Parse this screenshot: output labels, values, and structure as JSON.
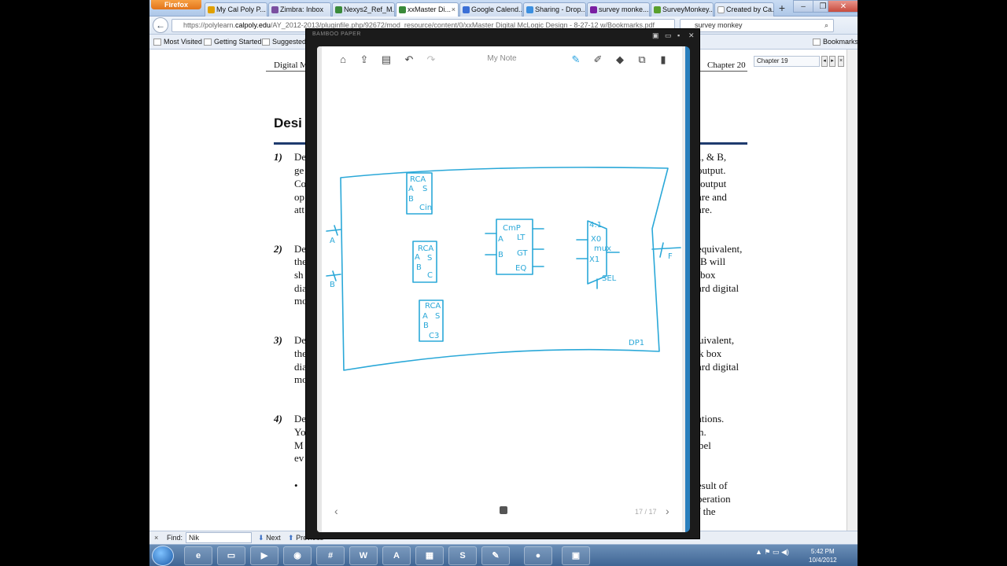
{
  "browser": {
    "app_button": "Firefox",
    "tabs": [
      {
        "label": "My Cal Poly P...",
        "color": "#e0a000"
      },
      {
        "label": "Zimbra: Inbox",
        "color": "#7a4fa0"
      },
      {
        "label": "Nexys2_Ref_M...",
        "color": "#3a8a3a"
      },
      {
        "label": "xxMaster Di...",
        "color": "#3a8a3a"
      },
      {
        "label": "Google Calend...",
        "color": "#3b6fd6"
      },
      {
        "label": "Sharing - Drop...",
        "color": "#3b8fe0"
      },
      {
        "label": "survey monke...",
        "color": "#7a1fa2"
      },
      {
        "label": "SurveyMonkey...",
        "color": "#5aa02c"
      },
      {
        "label": "Created by Ca...",
        "color": "#ffffff"
      }
    ],
    "url_prefix": "https://polylearn.",
    "url_domain": "calpoly.edu",
    "url_rest": "/AY_2012-2013/pluginfile.php/92672/mod_resource/content/0/xxMaster Digital McLogic Design - 8-27-12 w/Bookmarks.pdf",
    "search_value": "survey monkey",
    "bookmarks": [
      "Most Visited",
      "Getting Started",
      "Suggested Sites"
    ],
    "bookmarks_right": "Bookmarks"
  },
  "pdf": {
    "header_left": "Digital M",
    "header_right": "Chapter 20",
    "chapter_search": "Chapter 19",
    "heading": "Desi",
    "items": [
      {
        "num": "1)",
        "lines_left": [
          "De",
          "ge",
          "Co",
          "op",
          "att"
        ],
        "lines_right": [
          "A, & B,",
          "output.",
          "output",
          "are and",
          "are."
        ]
      },
      {
        "num": "2)",
        "lines_left": [
          "De",
          "the",
          "sh",
          "dia",
          "mo"
        ],
        "lines_right": [
          "equivalent,",
          "B will",
          "box",
          "ard digital",
          ""
        ]
      },
      {
        "num": "3)",
        "lines_left": [
          "De",
          "the",
          "dia",
          "mo"
        ],
        "lines_right": [
          "uivalent,",
          "k box",
          "ard digital",
          ""
        ]
      },
      {
        "num": "4)",
        "lines_left": [
          "De",
          "Yo",
          "M",
          "ev"
        ],
        "lines_right": [
          "ations.",
          "n.",
          "bel",
          ""
        ]
      }
    ],
    "bullet_right": [
      "esult of",
      "peration",
      "f the"
    ]
  },
  "find": {
    "label": "Find:",
    "value": "Nik",
    "next": "Next",
    "prev": "Previous"
  },
  "bamboo": {
    "window_title": "BAMBOO PAPER",
    "note_title": "My Note",
    "page_indicator": "17 / 17",
    "ink_color": "#2aa8d8",
    "sketch_labels": [
      "RCA",
      "A",
      "S",
      "B",
      "Cin",
      "RCA",
      "A",
      "S",
      "B",
      "C",
      "RCA",
      "A",
      "S",
      "B",
      "C3",
      "CmP",
      "A",
      "LT",
      "B",
      "GT",
      "EQ",
      "4:1",
      "X0",
      "mux",
      "X1",
      "SEL",
      "A",
      "B",
      "F",
      "DP1"
    ]
  },
  "taskbar": {
    "time": "5:42 PM",
    "date": "10/4/2012",
    "apps": [
      "ie",
      "explorer",
      "media",
      "firefox",
      "slack",
      "word",
      "acrobat",
      "calc",
      "skype",
      "paint",
      "camtasia",
      "bamboo"
    ]
  }
}
